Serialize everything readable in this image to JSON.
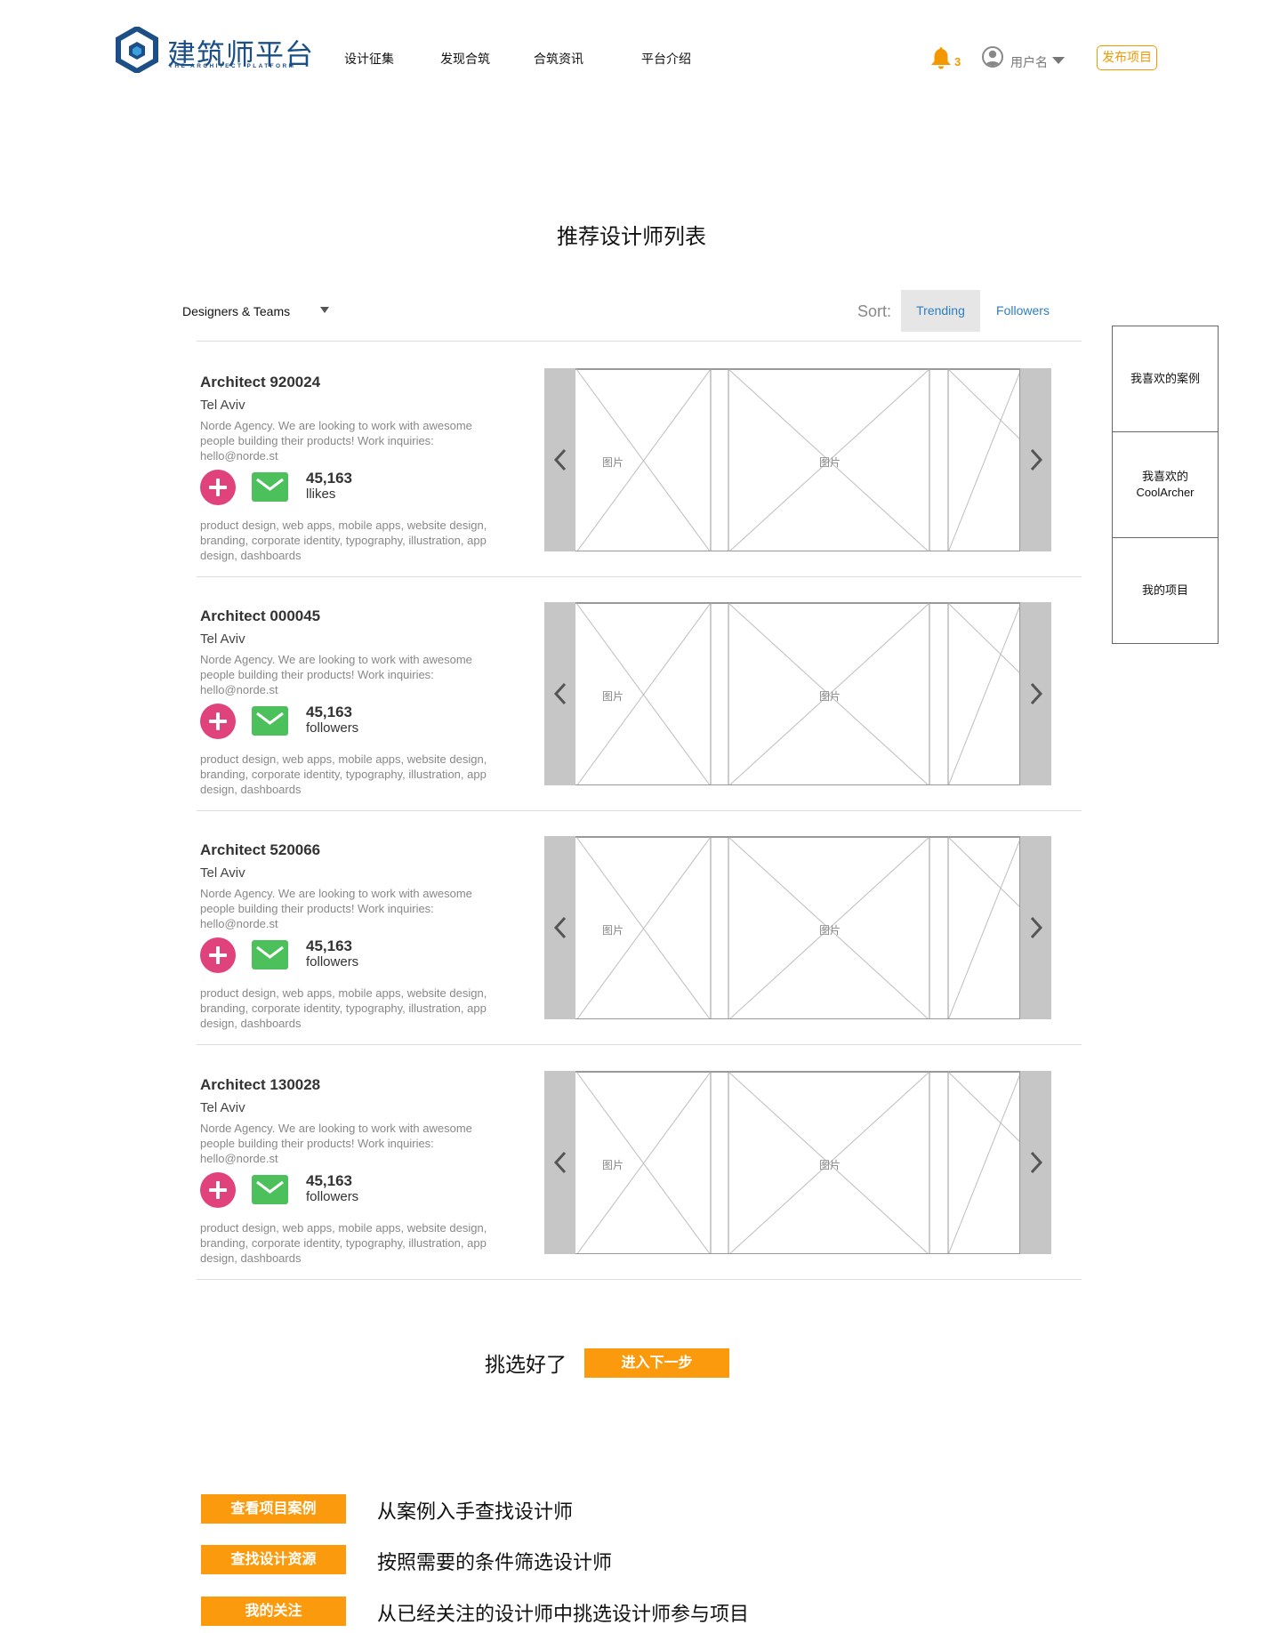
{
  "header": {
    "logo_cn": "建筑师平台",
    "logo_en": "THE ARCHITECT PLATFORM",
    "nav": [
      "设计征集",
      "发现合筑",
      "合筑资讯",
      "平台介绍"
    ],
    "notification_count": "3",
    "username": "用户名",
    "publish_label": "发布项目"
  },
  "page_title": "推荐设计师列表",
  "filter": {
    "selected": "Designers & Teams"
  },
  "sort": {
    "label": "Sort:",
    "options": [
      "Trending",
      "Followers"
    ],
    "active": "Trending"
  },
  "designers": [
    {
      "name": "Architect 920024",
      "city": "Tel Aviv",
      "bio": "Norde Agency. We are looking to work with awesome people building their products! Work inquiries: hello@norde.st",
      "stat_value": "45,163",
      "stat_label": "llikes",
      "tags": "product design, web apps, mobile apps, website design, branding, corporate identity, typography, illustration, app design, dashboards",
      "image_labels": [
        "图片",
        "图片"
      ]
    },
    {
      "name": "Architect 000045",
      "city": "Tel Aviv",
      "bio": "Norde Agency. We are looking to work with awesome people building their products! Work inquiries: hello@norde.st",
      "stat_value": "45,163",
      "stat_label": "followers",
      "tags": "product design, web apps, mobile apps, website design, branding, corporate identity, typography, illustration, app design, dashboards",
      "image_labels": [
        "图片",
        "图片"
      ]
    },
    {
      "name": "Architect 520066",
      "city": "Tel Aviv",
      "bio": "Norde Agency. We are looking to work with awesome people building their products! Work inquiries: hello@norde.st",
      "stat_value": "45,163",
      "stat_label": "followers",
      "tags": "product design, web apps, mobile apps, website design, branding, corporate identity, typography, illustration, app design, dashboards",
      "image_labels": [
        "图片",
        "图片"
      ]
    },
    {
      "name": "Architect 130028",
      "city": "Tel Aviv",
      "bio": "Norde Agency. We are looking to work with awesome people building their products! Work inquiries: hello@norde.st",
      "stat_value": "45,163",
      "stat_label": "followers",
      "tags": "product design, web apps, mobile apps, website design, branding, corporate identity, typography, illustration, app design, dashboards",
      "image_labels": [
        "图片",
        "图片"
      ]
    }
  ],
  "side_panel": [
    "我喜欢的案例",
    "我喜欢的 CoolArcher",
    "我的项目"
  ],
  "next_step": {
    "label": "挑选好了",
    "button": "进入下一步"
  },
  "footer_links": [
    {
      "button": "查看项目案例",
      "desc": "从案例入手查找设计师"
    },
    {
      "button": "查找设计资源",
      "desc": "按照需要的条件筛选设计师"
    },
    {
      "button": "我的关注",
      "desc": "从已经关注的设计师中挑选设计师参与项目"
    }
  ],
  "colors": {
    "brand": "#1b4f86",
    "accent": "#f39800",
    "follow": "#e0427c",
    "mail": "#4cc05a",
    "link": "#2d7fc1"
  },
  "icons": [
    "logo-mark-icon",
    "bell-icon",
    "user-avatar-icon",
    "caret-down-icon",
    "plus-icon",
    "mail-icon",
    "chevron-left-icon",
    "chevron-right-icon"
  ]
}
